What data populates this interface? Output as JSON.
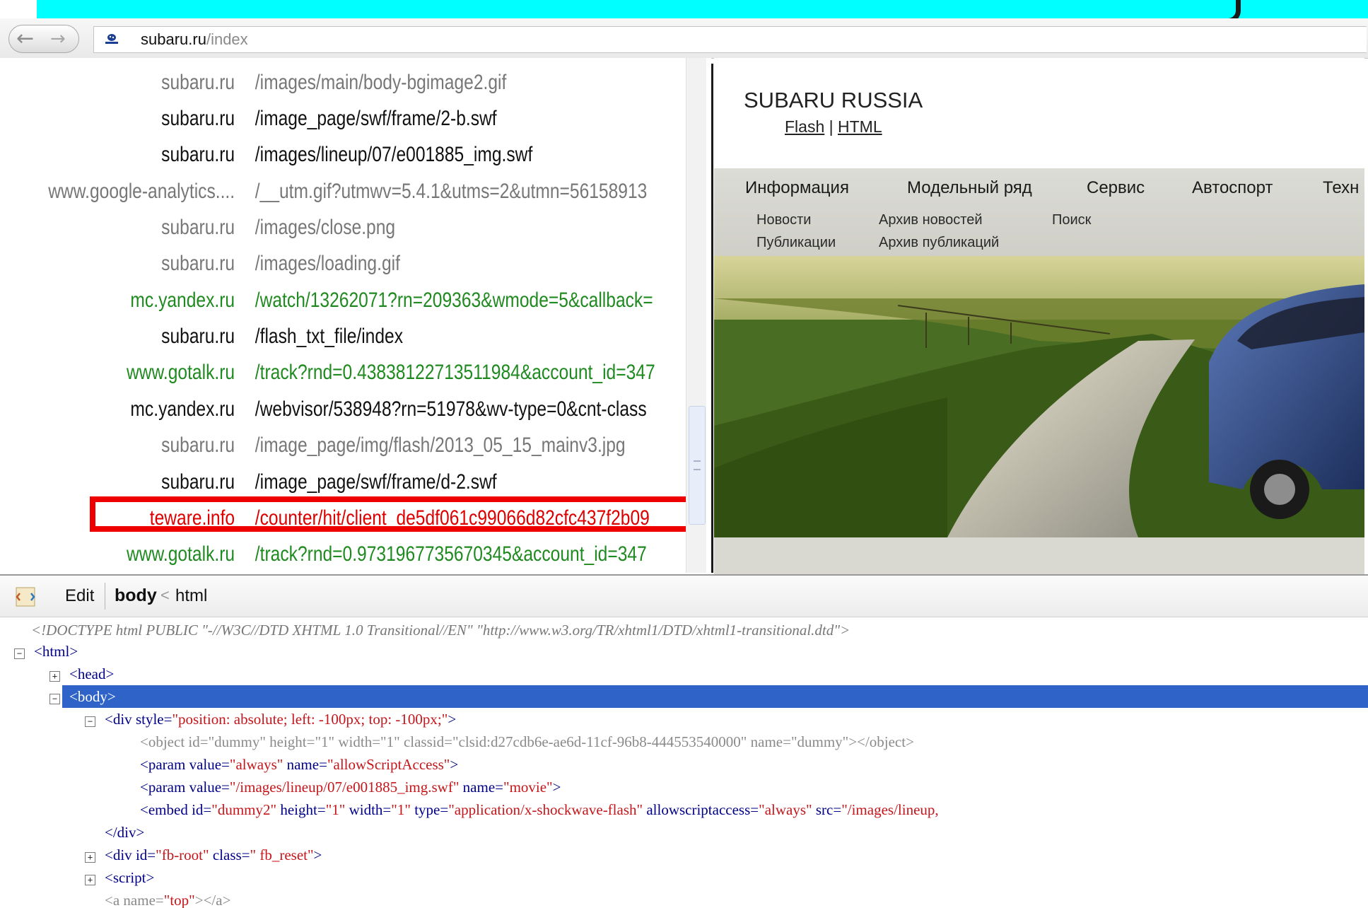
{
  "browser": {
    "url_domain": "subaru.ru",
    "url_path": "/index"
  },
  "network": {
    "rows": [
      {
        "domain": "subaru.ru",
        "file": "/images/main/body-bgimage2.gif",
        "color": "#777777"
      },
      {
        "domain": "subaru.ru",
        "file": "/image_page/swf/frame/2-b.swf",
        "color": "#111111"
      },
      {
        "domain": "subaru.ru",
        "file": "/images/lineup/07/e001885_img.swf",
        "color": "#111111"
      },
      {
        "domain": "www.google-analytics....",
        "file": "/__utm.gif?utmwv=5.4.1&utms=2&utmn=56158913",
        "color": "#777777"
      },
      {
        "domain": "subaru.ru",
        "file": "/images/close.png",
        "color": "#777777"
      },
      {
        "domain": "subaru.ru",
        "file": "/images/loading.gif",
        "color": "#777777"
      },
      {
        "domain": "mc.yandex.ru",
        "file": "/watch/13262071?rn=209363&wmode=5&callback=",
        "color": "#1f8a1f"
      },
      {
        "domain": "subaru.ru",
        "file": "/flash_txt_file/index",
        "color": "#111111"
      },
      {
        "domain": "www.gotalk.ru",
        "file": "/track?rnd=0.43838122713511984&account_id=347",
        "color": "#1f8a1f"
      },
      {
        "domain": "mc.yandex.ru",
        "file": "/webvisor/538948?rn=51978&wv-type=0&cnt-class",
        "color": "#111111"
      },
      {
        "domain": "subaru.ru",
        "file": "/image_page/img/flash/2013_05_15_mainv3.jpg",
        "color": "#777777"
      },
      {
        "domain": "subaru.ru",
        "file": "/image_page/swf/frame/d-2.swf",
        "color": "#111111"
      },
      {
        "domain": "teware.info",
        "file": "/counter/hit/client_de5df061c99066d82cfc437f2b09",
        "color": "#dd0000"
      },
      {
        "domain": "www.gotalk.ru",
        "file": "/track?rnd=0.9731967735670345&account_id=347",
        "color": "#1f8a1f"
      }
    ]
  },
  "preview": {
    "site_title": "SUBARU RUSSIA",
    "link_flash": "Flash",
    "link_sep": "|",
    "link_html": "HTML",
    "menu": [
      "Информация",
      "Модельный ряд",
      "Сервис",
      "Автоспорт",
      "Техн"
    ],
    "submenu_row1": [
      "Новости",
      "Архив новостей",
      "Поиск"
    ],
    "submenu_row2": [
      "Публикации",
      "Архив публикаций"
    ]
  },
  "inspector": {
    "edit_label": "Edit",
    "crumb_current": "body",
    "crumb_sep": "<",
    "crumb_parent": "html"
  },
  "dom": {
    "doctype": "<!DOCTYPE html PUBLIC \"-//W3C//DTD XHTML 1.0 Transitional//EN\" \"http://www.w3.org/TR/xhtml1/DTD/xhtml1-transitional.dtd\">",
    "html_open": "<html>",
    "head": "<head>",
    "body": "<body>",
    "div_open_tag": "<div",
    "div_style_name": "style=",
    "div_style_val": "\"position: absolute; left: -100px; top: -100px;\"",
    "div_close_bracket": ">",
    "object_line": "<object id=\"dummy\" height=\"1\" width=\"1\" classid=\"clsid:d27cdb6e-ae6d-11cf-96b8-444553540000\" name=\"dummy\"></object>",
    "param1_tag": "<param",
    "param1_value_name": "value=",
    "param1_value_val": "\"always\"",
    "param1_name_name": "name=",
    "param1_name_val": "\"allowScriptAccess\"",
    "param1_close": ">",
    "param2_tag": "<param",
    "param2_value_name": "value=",
    "param2_value_val": "\"/images/lineup/07/e001885_img.swf\"",
    "param2_name_name": "name=",
    "param2_name_val": "\"movie\"",
    "param2_close": ">",
    "embed_tag": "<embed",
    "embed_id_name": "id=",
    "embed_id_val": "\"dummy2\"",
    "embed_height_name": "height=",
    "embed_height_val": "\"1\"",
    "embed_width_name": "width=",
    "embed_width_val": "\"1\"",
    "embed_type_name": "type=",
    "embed_type_val": "\"application/x-shockwave-flash\"",
    "embed_asa_name": "allowscriptaccess=",
    "embed_asa_val": "\"always\"",
    "embed_src_name": "src=",
    "embed_src_val": "\"/images/lineup,",
    "div_close": "</div>",
    "fbroot_tag": "<div",
    "fbroot_id_name": "id=",
    "fbroot_id_val": "\"fb-root\"",
    "fbroot_class_name": "class=",
    "fbroot_class_val": "\" fb_reset\"",
    "fbroot_close": ">",
    "script": "<script>",
    "a_top_tag": "<a",
    "a_top_name": "name=",
    "a_top_val": "\"top\"",
    "a_top_close": "></a>"
  }
}
